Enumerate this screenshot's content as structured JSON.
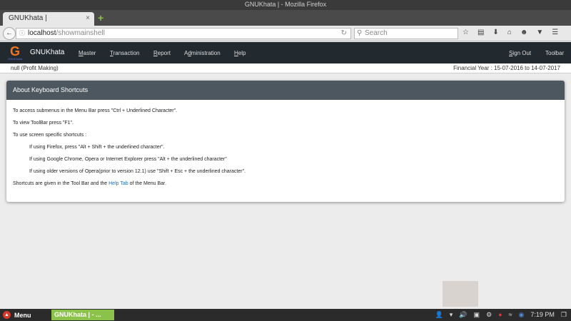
{
  "window": {
    "title": "GNUKhata | - Mozilla Firefox"
  },
  "browser": {
    "tab_label": "GNUKhata |",
    "tab_close": "×",
    "new_tab": "+",
    "back": "←",
    "url_host": "localhost",
    "url_path": "/showmainshell",
    "reload": "↻",
    "search_placeholder": "Search",
    "toolbar_icons": [
      "☆",
      "▤",
      "⬇",
      "⌂",
      "☻",
      "▼",
      "☰"
    ]
  },
  "app": {
    "brand": "GNUKhata",
    "logo_letter": "G",
    "logo_sub": "GNUKhata",
    "menu": [
      {
        "u": "M",
        "rest": "aster"
      },
      {
        "u": "T",
        "rest": "ransaction"
      },
      {
        "u": "R",
        "rest": "eport"
      },
      {
        "pre": "A",
        "u": "d",
        "rest": "ministration"
      },
      {
        "u": "H",
        "rest": "elp"
      }
    ],
    "signout": {
      "u": "S",
      "rest": "ign Out"
    },
    "toolbar": "Toolbar"
  },
  "infobar": {
    "org": "null (Profit Making)",
    "financial_year": "Financial Year : 15-07-2016 to 14-07-2017"
  },
  "card": {
    "title": "About Keyboard Shortcuts",
    "lines": [
      "To access submenus in the Menu Bar press \"Ctrl + Underlined Character\".",
      "To view ToolBar press \"F1\".",
      "To use screen specific shortcuts :",
      "If using Firefox, press \"Alt + Shift + the underlined character\".",
      "If using Google Chrome, Opera or Internet Explorer press \"Alt + the underlined character\"",
      "If using older versions of Opera(prior to version 12.1) use \"Shift + Esc + the underlined character\"."
    ],
    "last_pre": "Shortcuts are given in the Tool Bar and the ",
    "last_link": "Help Tab",
    "last_post": " of the Menu Bar."
  },
  "taskbar": {
    "menu": "Menu",
    "task": "GNUKhata | - ...",
    "time": "7:19 PM",
    "tray_icons": [
      "👤",
      "▾",
      "🔊",
      "▣",
      "⚙",
      "●",
      "≈",
      "◉"
    ]
  }
}
